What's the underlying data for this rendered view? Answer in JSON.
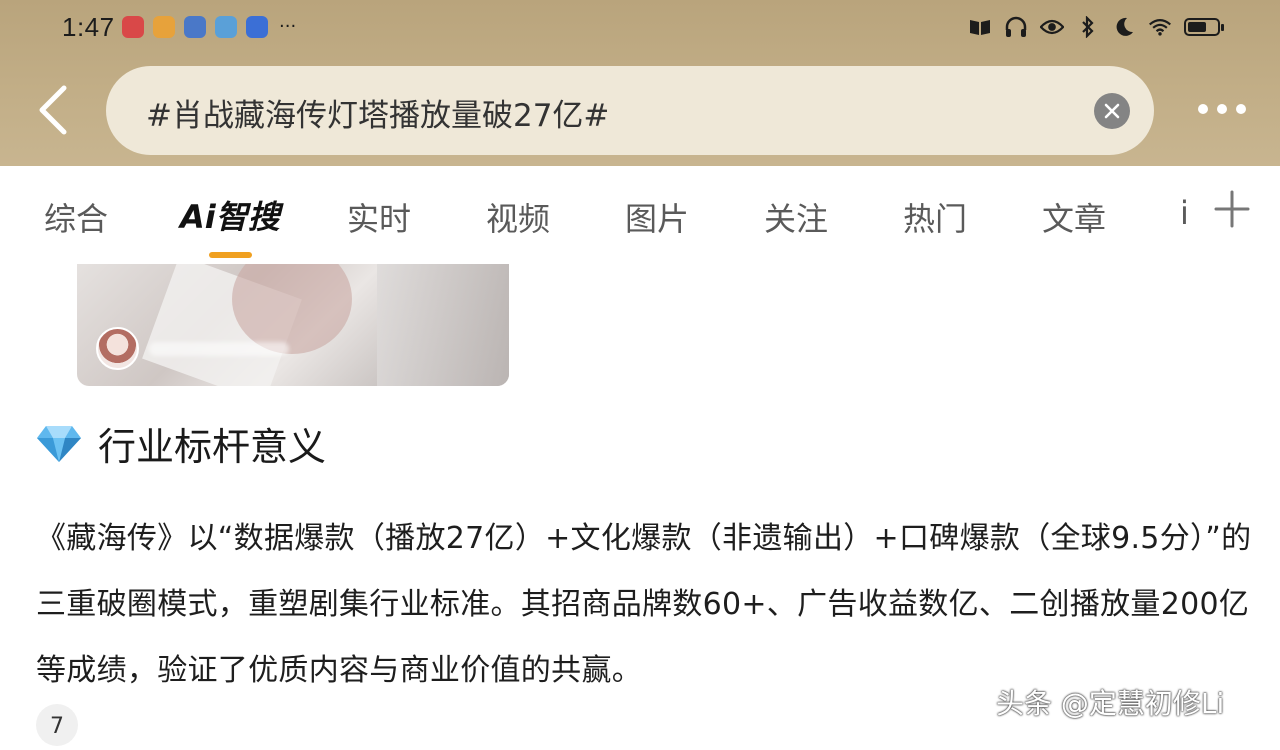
{
  "status_bar": {
    "time": "1:47",
    "more": "···"
  },
  "header": {
    "search_query": "#肖战藏海传灯塔播放量破27亿#"
  },
  "tabs": [
    {
      "label": "综合"
    },
    {
      "label": "Ai智搜",
      "active": true
    },
    {
      "label": "实时"
    },
    {
      "label": "视频"
    },
    {
      "label": "图片"
    },
    {
      "label": "关注"
    },
    {
      "label": "热门"
    },
    {
      "label": "文章"
    },
    {
      "label": "i"
    }
  ],
  "section": {
    "title": "行业标杆意义",
    "icon": "diamond-icon"
  },
  "paragraph": "《藏海传》以“数据爆款（播放27亿）+文化爆款（非遗输出）+口碑爆款（全球9.5分）”的三重破圈模式，重塑剧集行业标准。其招商品牌数60+、广告收益数亿、二创播放量200亿等成绩，验证了优质内容与商业价值的共赢。",
  "comment_count": "7",
  "watermark": "头条 @定慧初修Li",
  "colors": {
    "header_bg": "#c2ae87",
    "search_bg": "#efe8d8",
    "tab_underline": "#f0a020"
  }
}
